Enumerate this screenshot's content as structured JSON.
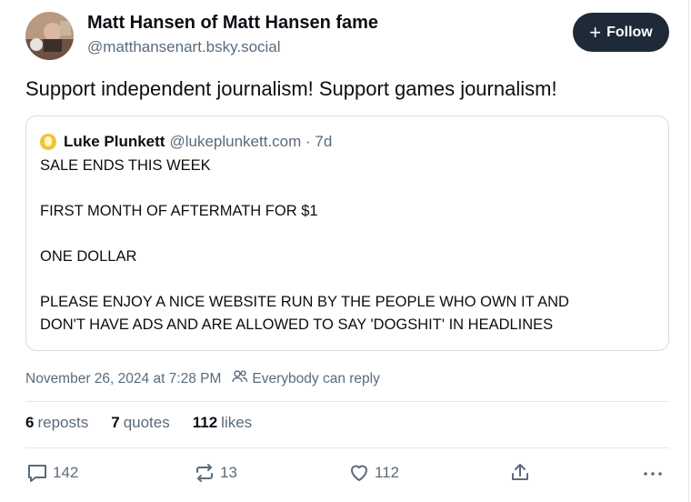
{
  "author": {
    "display_name": "Matt Hansen of Matt Hansen fame",
    "handle": "@matthansenart.bsky.social"
  },
  "follow_button": {
    "label": "Follow",
    "icon": "plus-icon"
  },
  "post": {
    "text": "Support independent journalism! Support games journalism!"
  },
  "quote": {
    "author_name": "Luke Plunkett",
    "handle_time": "@lukeplunkett.com · 7d",
    "lines": [
      "SALE ENDS THIS WEEK",
      "FIRST MONTH OF AFTERMATH FOR $1",
      "ONE DOLLAR",
      "PLEASE ENJOY A NICE WEBSITE RUN BY THE PEOPLE WHO OWN IT AND",
      "DON'T HAVE ADS AND ARE ALLOWED TO SAY 'DOGSHIT' IN HEADLINES"
    ]
  },
  "meta": {
    "timestamp": "November 26, 2024 at 7:28 PM",
    "reply_setting": "Everybody can reply"
  },
  "stats": {
    "reposts_count": "6",
    "reposts_label": "reposts",
    "quotes_count": "7",
    "quotes_label": "quotes",
    "likes_count": "112",
    "likes_label": "likes"
  },
  "actions": {
    "reply_count": "142",
    "repost_count": "13",
    "like_count": "112"
  },
  "colors": {
    "follow_bg": "#1e2a37",
    "muted_text": "#5b6b7b",
    "divider": "#e3e7ec"
  }
}
